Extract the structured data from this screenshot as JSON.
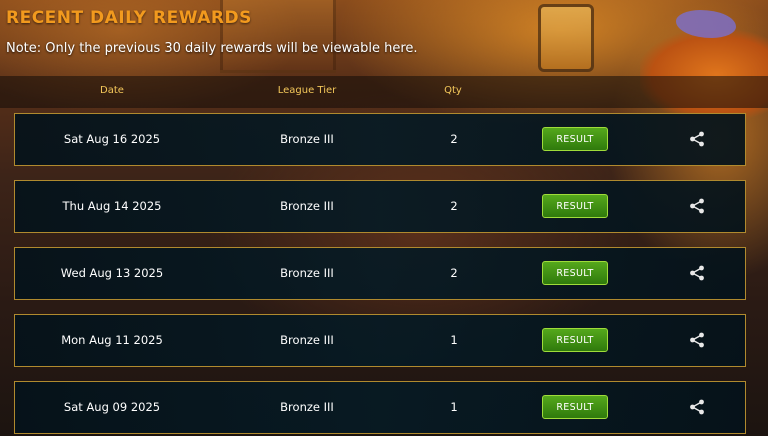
{
  "page": {
    "title": "RECENT DAILY REWARDS",
    "note": "Note: Only the previous 30 daily rewards will be viewable here."
  },
  "table": {
    "headers": {
      "date": "Date",
      "league_tier": "League Tier",
      "qty": "Qty"
    },
    "rows": [
      {
        "date": "Sat Aug 16 2025",
        "league_tier": "Bronze III",
        "qty": "2",
        "button_label": "RESULT"
      },
      {
        "date": "Thu Aug 14 2025",
        "league_tier": "Bronze III",
        "qty": "2",
        "button_label": "RESULT"
      },
      {
        "date": "Wed Aug 13 2025",
        "league_tier": "Bronze III",
        "qty": "2",
        "button_label": "RESULT"
      },
      {
        "date": "Mon Aug 11 2025",
        "league_tier": "Bronze III",
        "qty": "1",
        "button_label": "RESULT"
      },
      {
        "date": "Sat Aug 09 2025",
        "league_tier": "Bronze III",
        "qty": "1",
        "button_label": "RESULT"
      }
    ]
  },
  "icons": {
    "share": "share-icon"
  },
  "colors": {
    "title": "#f29a1e",
    "header_text": "#f3c75a",
    "row_border": "#b08a2e",
    "button_green": "#3f8f14"
  }
}
